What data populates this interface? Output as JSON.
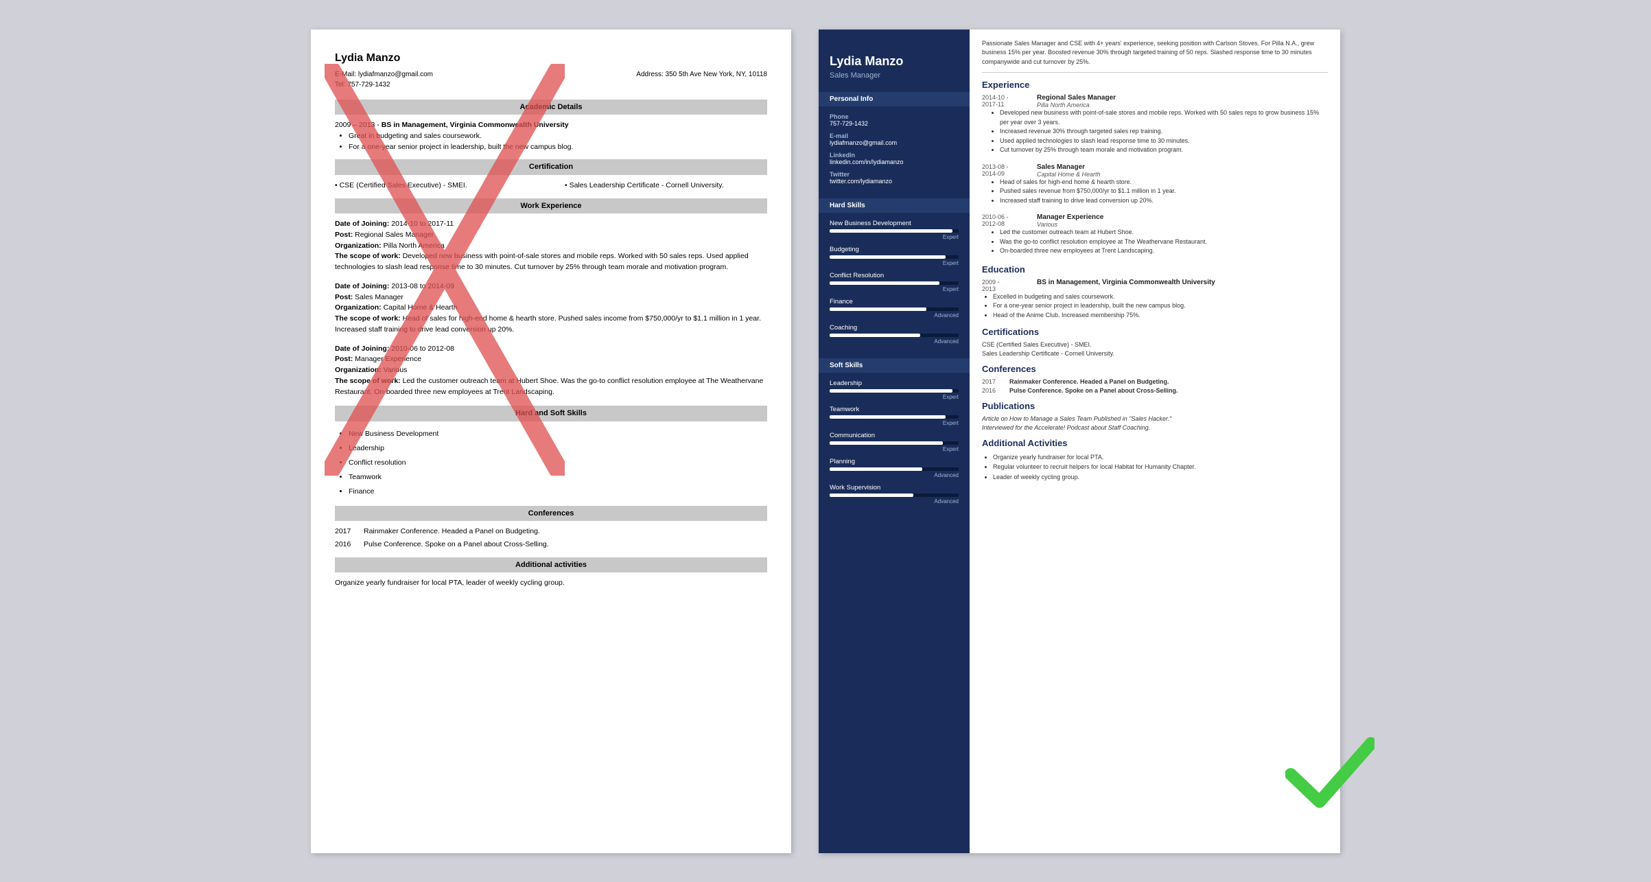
{
  "left": {
    "name": "Lydia Manzo",
    "email_label": "E-Mail:",
    "email": "lydiafmanzo@gmail.com",
    "address_label": "Address:",
    "address": "350 5th Ave New York, NY, 10118",
    "tel_label": "Tel:",
    "tel": "757-729-1432",
    "sections": {
      "academic": "Academic Details",
      "certification": "Certification",
      "work_experience": "Work Experience",
      "hard_soft_skills": "Hard and Soft Skills",
      "conferences": "Conferences",
      "additional": "Additional activities"
    },
    "education": {
      "years": "2009 – 2013 -",
      "degree": "BS in Management, Virginia Commonwealth University",
      "bullets": [
        "Great in budgeting and sales coursework.",
        "For a one-year senior project in leadership, built the new campus blog."
      ]
    },
    "certifications": [
      "CSE (Certified Sales Executive) - SMEI.",
      "Sales Leadership Certificate - Cornell University."
    ],
    "work": [
      {
        "date_label": "Date of Joining:",
        "date": "2014-10 to 2017-11",
        "post_label": "Post:",
        "post": "Regional Sales Manager",
        "org_label": "Organization:",
        "org": "Pilla North America",
        "scope_label": "The scope of work:",
        "scope": "Developed new business with point-of-sale stores and mobile reps. Worked with 50 sales reps. Used applied technologies to slash lead response time to 30 minutes. Cut turnover by 25% through team morale and motivation program."
      },
      {
        "date_label": "Date of Joining:",
        "date": "2013-08 to 2014-09",
        "post_label": "Post:",
        "post": "Sales Manager",
        "org_label": "Organization:",
        "org": "Capital Home & Hearth",
        "scope_label": "The scope of work:",
        "scope": "Head of sales for high-end home & hearth store. Pushed sales income from $750,000/yr to $1.1 million in 1 year. Increased staff training to drive lead conversion up 20%."
      },
      {
        "date_label": "Date of Joining:",
        "date": "2010-06 to 2012-08",
        "post_label": "Post:",
        "post": "Manager Experience",
        "org_label": "Organization:",
        "org": "Various",
        "scope_label": "The scope of work:",
        "scope": "Led the customer outreach team at Hubert Shoe. Was the go-to conflict resolution employee at The Weathervane Restaurant. On-boarded three new employees at Trent Landscaping."
      }
    ],
    "skills": [
      "New Business Development",
      "Leadership",
      "Conflict resolution",
      "Teamwork",
      "Finance"
    ],
    "conferences": [
      {
        "year": "2017",
        "text": "Rainmaker Conference. Headed a Panel on Budgeting."
      },
      {
        "year": "2016",
        "text": "Pulse Conference. Spoke on a Panel about Cross-Selling."
      }
    ],
    "additional": "Organize yearly fundraiser for local PTA, leader of weekly cycling group."
  },
  "right": {
    "name": "Lydia Manzo",
    "title": "Sales Manager",
    "summary": "Passionate Sales Manager and CSE with 4+ years' experience, seeking position with Carlson Stoves. For Pilla N.A., grew business 15% per year. Boosted revenue 30% through targeted training of 50 reps. Slashed response time to 30 minutes companywide and cut turnover by 25%.",
    "personal_info_title": "Personal Info",
    "phone_label": "Phone",
    "phone": "757-729-1432",
    "email_label": "E-mail",
    "email": "lydiafmanzo@gmail.com",
    "linkedin_label": "LinkedIn",
    "linkedin": "linkedin.com/in/lydiamanzo",
    "twitter_label": "Twitter",
    "twitter": "twitter.com/lydiamanzo",
    "hard_skills_title": "Hard Skills",
    "hard_skills": [
      {
        "name": "New Business Development",
        "level": "Expert",
        "pct": 95
      },
      {
        "name": "Budgeting",
        "level": "Expert",
        "pct": 90
      },
      {
        "name": "Conflict Resolution",
        "level": "Expert",
        "pct": 85
      },
      {
        "name": "Finance",
        "level": "Advanced",
        "pct": 75
      },
      {
        "name": "Coaching",
        "level": "Advanced",
        "pct": 70
      }
    ],
    "soft_skills_title": "Soft Skills",
    "soft_skills": [
      {
        "name": "Leadership",
        "level": "Expert",
        "pct": 95
      },
      {
        "name": "Teamwork",
        "level": "Expert",
        "pct": 90
      },
      {
        "name": "Communication",
        "level": "Expert",
        "pct": 88
      },
      {
        "name": "Planning",
        "level": "Advanced",
        "pct": 72
      },
      {
        "name": "Work Supervision",
        "level": "Advanced",
        "pct": 65
      }
    ],
    "experience_title": "Experience",
    "experience": [
      {
        "dates": "2014-10 -\n2017-11",
        "title": "Regional Sales Manager",
        "company": "Pilla North America",
        "bullets": [
          "Developed new business with point-of-sale stores and mobile reps. Worked with 50 sales reps to grow business 15% per year over 3 years.",
          "Increased revenue 30% through targeted sales rep training.",
          "Used applied technologies to slash lead response time to 30 minutes.",
          "Cut turnover by 25% through team morale and motivation program."
        ]
      },
      {
        "dates": "2013-08 -\n2014-09",
        "title": "Sales Manager",
        "company": "Capital Home & Hearth",
        "bullets": [
          "Head of sales for high-end home & hearth store.",
          "Pushed sales revenue from $750,000/yr to $1.1 million in 1 year.",
          "Increased staff training to drive lead conversion up 20%."
        ]
      },
      {
        "dates": "2010-06 -\n2012-08",
        "title": "Manager Experience",
        "company": "Various",
        "bullets": [
          "Led the customer outreach team at Hubert Shoe.",
          "Was the go-to conflict resolution employee at The Weathervane Restaurant.",
          "On-boarded three new employees at Trent Landscaping."
        ]
      }
    ],
    "education_title": "Education",
    "education": [
      {
        "dates": "2009 -\n2013",
        "degree": "BS in Management, Virginia Commonwealth University",
        "bullets": [
          "Excelled in budgeting and sales coursework.",
          "For a one-year senior project in leadership, built the new campus blog.",
          "Head of the Anime Club. Increased membership 75%."
        ]
      }
    ],
    "certifications_title": "Certifications",
    "certifications": [
      "CSE (Certified Sales Executive) - SMEI.",
      "Sales Leadership Certificate - Cornell University."
    ],
    "conferences_title": "Conferences",
    "conferences": [
      {
        "year": "2017",
        "text": "Rainmaker Conference. Headed a Panel on Budgeting."
      },
      {
        "year": "2016",
        "text": "Pulse Conference. Spoke on a Panel about Cross-Selling."
      }
    ],
    "publications_title": "Publications",
    "publications": [
      "Article on How to Manage a Sales Team Published in \"Sales Hacker.\"",
      "Interviewed for the Accelerate! Podcast about Staff Coaching."
    ],
    "additional_title": "Additional Activities",
    "additional": [
      "Organize yearly fundraiser for local PTA.",
      "Regular volunteer to recruit helpers for local Habitat for Humanity Chapter.",
      "Leader of weekly cycling group."
    ]
  }
}
